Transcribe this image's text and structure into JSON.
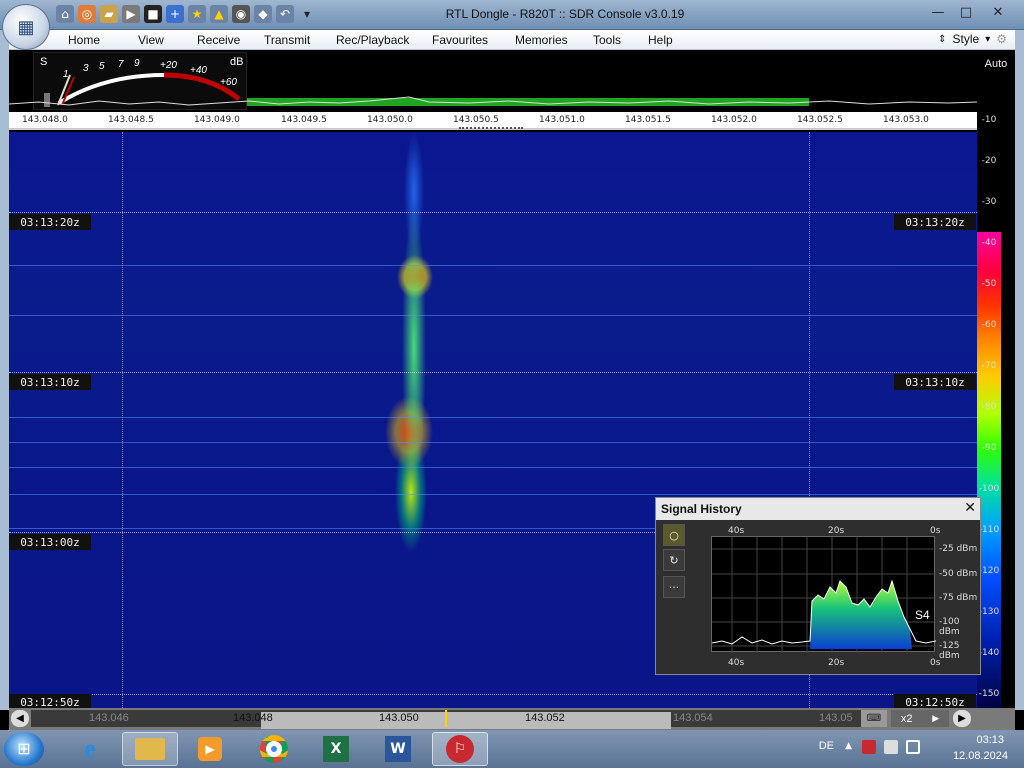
{
  "window": {
    "title": "RTL Dongle - R820T :: SDR Console v3.0.19"
  },
  "menu": {
    "items": [
      "Home",
      "View",
      "Receive",
      "Transmit",
      "Rec/Playback",
      "Favourites",
      "Memories",
      "Tools",
      "Help"
    ],
    "style_label": "Style"
  },
  "smeter": {
    "s_label": "S",
    "db_label": "dB",
    "scale_s": [
      "1",
      "3",
      "5",
      "7",
      "9"
    ],
    "scale_db": [
      "+20",
      "+40",
      "+60"
    ]
  },
  "frequency_axis": {
    "labels": [
      "143.048.0",
      "143.048.5",
      "143.049.0",
      "143.049.5",
      "143.050.0",
      "143.050.5",
      "143.051.0",
      "143.051.5",
      "143.052.0",
      "143.052.5",
      "143.053.0"
    ]
  },
  "db_scale": {
    "auto_label": "Auto",
    "ticks": [
      "-10",
      "-20",
      "-30",
      "-40",
      "-50",
      "-60",
      "-70",
      "-80",
      "-90",
      "-100",
      "-110",
      "-120",
      "-130",
      "-140",
      "-150"
    ]
  },
  "waterfall": {
    "timestamps": [
      "03:13:20z",
      "03:13:10z",
      "03:13:00z",
      "03:12:50z"
    ]
  },
  "signal_history": {
    "title": "Signal History",
    "close": "✕",
    "time_top": [
      "40s",
      "20s",
      "0s"
    ],
    "time_bottom": [
      "40s",
      "20s",
      "0s"
    ],
    "dbm_labels": [
      "-25 dBm",
      "-50 dBm",
      "-75 dBm",
      "-100 dBm",
      "-125 dBm"
    ],
    "s_reading": "S4",
    "buttons": [
      "○",
      "↻",
      "···"
    ]
  },
  "bottom_bar": {
    "freqs": [
      "143.046",
      "143.048",
      "143.050",
      "143.052",
      "143.054",
      "143.05"
    ],
    "zoom": "x2"
  },
  "taskbar": {
    "language": "DE",
    "time": "03:13",
    "date": "12.08.2024",
    "apps": [
      "internet-explorer",
      "file-explorer",
      "media-player",
      "chrome",
      "excel",
      "word",
      "sdr-console"
    ]
  }
}
